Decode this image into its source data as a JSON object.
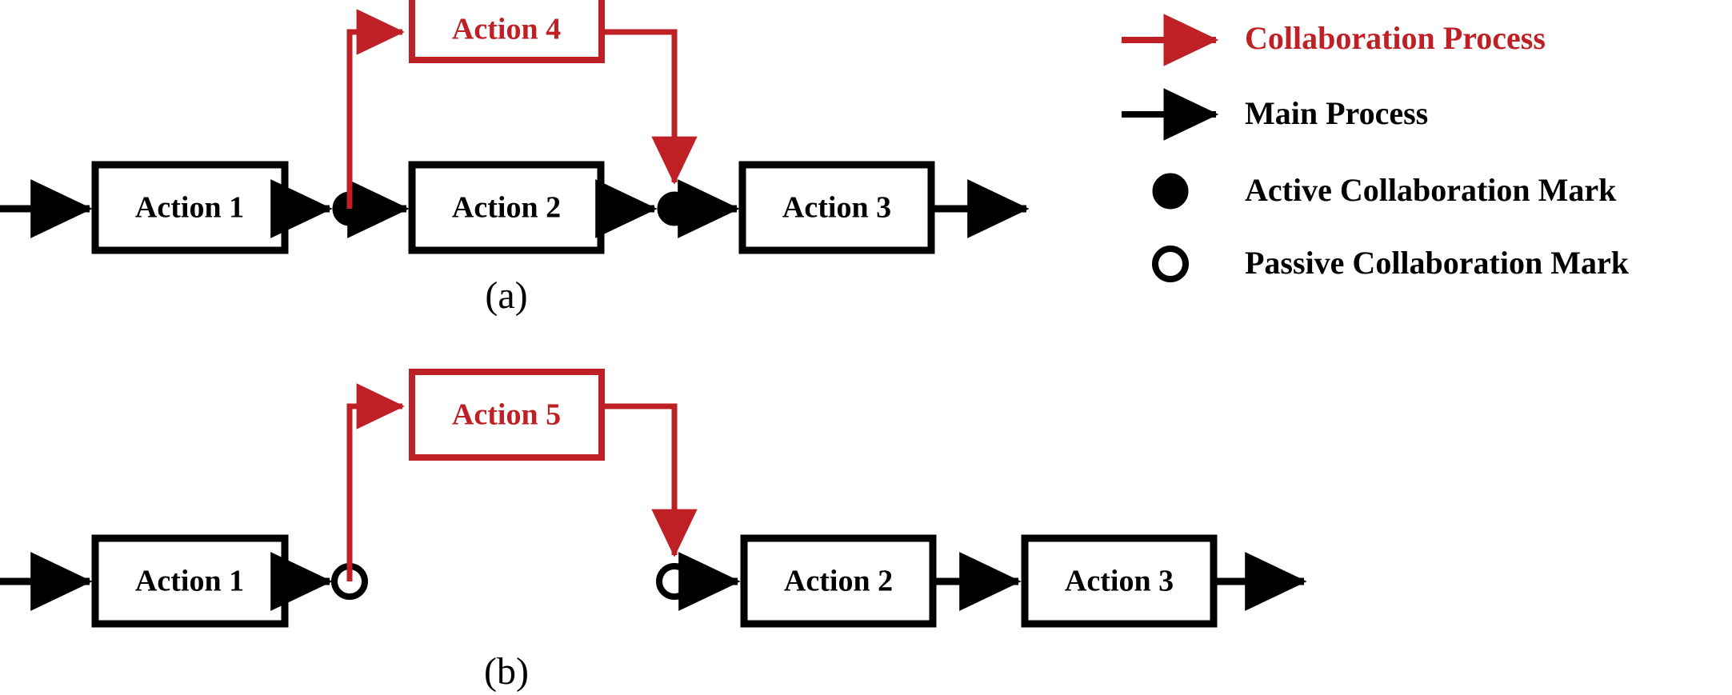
{
  "colors": {
    "collaboration": "#BF2026",
    "main": "#000000",
    "background": "#FFFFFF"
  },
  "panels": [
    {
      "id": "panel-a",
      "caption": "(a)",
      "main_nodes": [
        {
          "label": "Action 1"
        },
        {
          "label": "Action 2"
        },
        {
          "label": "Action 3"
        }
      ],
      "collaboration_nodes": [
        {
          "label": "Action 4"
        }
      ],
      "marks": [
        {
          "type": "active",
          "label": "Active Collaboration Mark"
        },
        {
          "type": "active",
          "label": "Active Collaboration Mark"
        }
      ]
    },
    {
      "id": "panel-b",
      "caption": "(b)",
      "main_nodes": [
        {
          "label": "Action 1"
        },
        {
          "label": "Action 2"
        },
        {
          "label": "Action 3"
        }
      ],
      "collaboration_nodes": [
        {
          "label": "Action 5"
        }
      ],
      "marks": [
        {
          "type": "passive",
          "label": "Passive Collaboration Mark"
        },
        {
          "type": "passive",
          "label": "Passive Collaboration Mark"
        }
      ]
    }
  ],
  "legend": {
    "items": [
      {
        "symbol": "arrow-red",
        "label": "Collaboration Process",
        "color": "#BF2026"
      },
      {
        "symbol": "arrow-black",
        "label": "Main Process",
        "color": "#000000"
      },
      {
        "symbol": "circle-filled",
        "label": "Active Collaboration Mark",
        "color": "#000000"
      },
      {
        "symbol": "circle-hollow",
        "label": "Passive Collaboration Mark",
        "color": "#000000"
      }
    ]
  }
}
